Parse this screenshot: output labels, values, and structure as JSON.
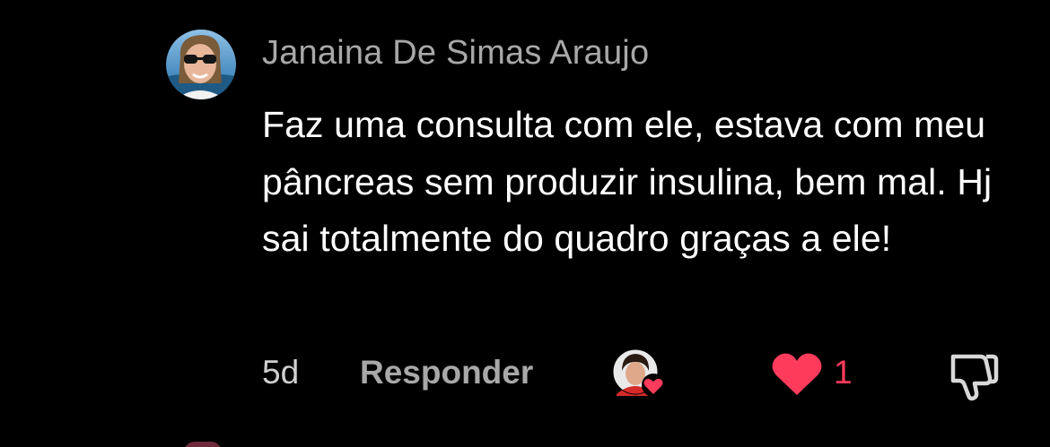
{
  "comment": {
    "author": "Janaina De Simas Araujo",
    "text": "Faz uma consulta com ele, estava com meu pâncreas sem produzir insulina, bem mal. Hj sai totalmente do quadro graças a ele!",
    "age": "5d",
    "reply_label": "Responder",
    "like_count": "1",
    "liked": true,
    "icons": {
      "avatar": "user-avatar",
      "liker_avatar": "creator-liked-avatar",
      "like": "heart-icon",
      "dislike": "thumbs-down-icon"
    }
  },
  "colors": {
    "background": "#000000",
    "author": "#a8a8a8",
    "body_text": "#ffffff",
    "meta": "#d0d0d0",
    "like_accent": "#ff3b5c"
  }
}
